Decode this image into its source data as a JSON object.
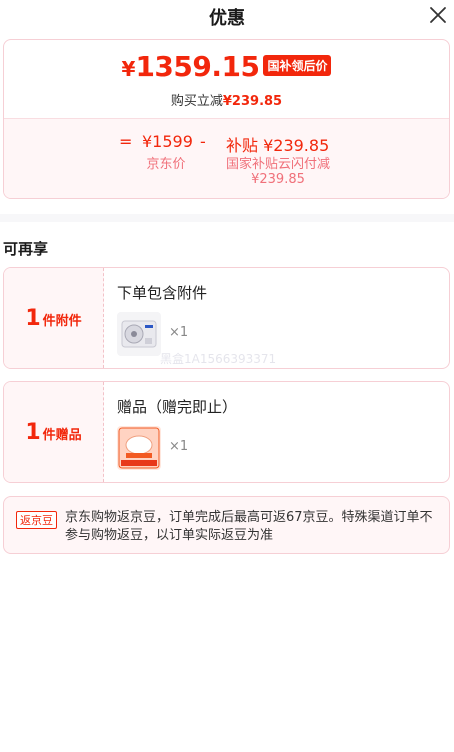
{
  "header": {
    "title": "优惠"
  },
  "price": {
    "symbol": "¥",
    "final_value": "1359.15",
    "tag": "国补领后价",
    "discount_prefix": "购买立减",
    "discount_amount": "¥239.85"
  },
  "breakdown": {
    "equals": "=",
    "jd_price": "¥1599",
    "minus": "-",
    "subsidy": "补贴 ¥239.85",
    "jd_price_label": "京东价",
    "subsidy_label_line1": "国家补贴云闪付减",
    "subsidy_label_line2": "¥239.85"
  },
  "section": {
    "title": "可再享"
  },
  "accessory": {
    "count": "1",
    "unit": "件附件",
    "title": "下单包含附件",
    "quantity": "×1"
  },
  "gift": {
    "count": "1",
    "unit": "件赠品",
    "title": "赠品（赠完即止）",
    "quantity": "×1"
  },
  "watermark": {
    "text": "黑盒1A1566393371"
  },
  "jd_bean": {
    "badge": "返京豆",
    "text": "京东购物返京豆，订单完成后最高可返67京豆。特殊渠道订单不参与购物返豆，以订单实际返豆为准"
  },
  "colors": {
    "accent_red": "#f2270c",
    "light_pink_bg": "#fff6f7",
    "border_pink": "#f6cfd5"
  }
}
